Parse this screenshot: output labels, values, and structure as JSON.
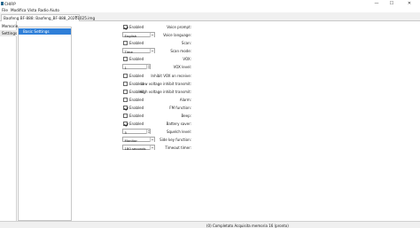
{
  "window": {
    "title": "CHIRP",
    "icon": "chirp-app-icon",
    "controls": {
      "minimize": "—",
      "maximize": "☐",
      "close": "✕"
    }
  },
  "menubar": {
    "items": [
      "File",
      "Modifica",
      "Vista",
      "Radio",
      "Aiuto"
    ]
  },
  "tab": {
    "label": "Baofeng BF-888: Baofeng_BF-888_20211025.img",
    "close": "✕"
  },
  "leftnav": {
    "items": [
      "Memorie",
      "Settings"
    ]
  },
  "settings_tree": {
    "selected": "Basic Settings"
  },
  "settings": {
    "voice_prompt": {
      "label": "Voice prompt:",
      "checked": true,
      "text": "Enabled"
    },
    "voice_language": {
      "label": "Voice language:",
      "value": "English"
    },
    "scan": {
      "label": "Scan:",
      "checked": false,
      "text": "Enabled"
    },
    "scan_mode": {
      "label": "Scan mode:",
      "value": "Time"
    },
    "vox": {
      "label": "VOX:",
      "checked": false,
      "text": "Enabled"
    },
    "vox_level": {
      "label": "VOX level:",
      "value": "1"
    },
    "inhibit_vox": {
      "label": "Inhibit VOX on receive:",
      "checked": false,
      "text": "Enabled"
    },
    "low_voltage": {
      "label": "Low voltage inhibit transmit:",
      "checked": false,
      "text": "Enabled"
    },
    "high_voltage": {
      "label": "High voltage inhibit transmit:",
      "checked": false,
      "text": "Enabled"
    },
    "alarm": {
      "label": "Alarm:",
      "checked": false,
      "text": "Enabled"
    },
    "fm_function": {
      "label": "FM function:",
      "checked": true,
      "text": "Enabled"
    },
    "beep": {
      "label": "Beep:",
      "checked": false,
      "text": "Enabled"
    },
    "battery_saver": {
      "label": "Battery saver:",
      "checked": true,
      "text": "Enabled"
    },
    "squelch": {
      "label": "Squelch level:",
      "value": "5"
    },
    "side_key": {
      "label": "Side key function:",
      "value": "Monitor"
    },
    "timeout_timer": {
      "label": "Timeout timer:",
      "value": "180 seconds"
    }
  },
  "statusbar": {
    "text": "(0) Completato Acquisita memoria 16 (pronto)"
  }
}
